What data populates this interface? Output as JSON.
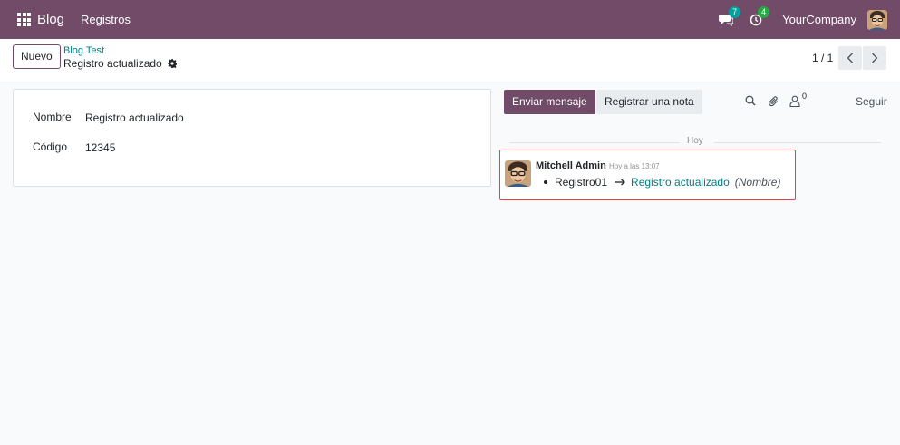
{
  "app": {
    "brand": "Blog",
    "menu_item": "Registros"
  },
  "systray": {
    "messages_count": "7",
    "activities_count": "4",
    "company": "YourCompany",
    "colors": {
      "navbar": "#714b67",
      "messages_badge": "#00a09d",
      "activities_badge": "#28a745"
    }
  },
  "control_panel": {
    "new_button": "Nuevo",
    "breadcrumb_parent": "Blog Test",
    "breadcrumb_current": "Registro actualizado",
    "pager_value": "1 / 1"
  },
  "form": {
    "fields": [
      {
        "label": "Nombre",
        "value": "Registro actualizado"
      },
      {
        "label": "Código",
        "value": "12345"
      }
    ]
  },
  "chatter": {
    "send_message": "Enviar mensaje",
    "log_note": "Registrar una nota",
    "followers_count": "0",
    "follow": "Seguir",
    "date_separator": "Hoy",
    "message": {
      "author": "Mitchell Admin",
      "date": "Hoy a las 13:07",
      "old_value": "Registro01",
      "new_value": "Registro actualizado",
      "field_name": "(Nombre)",
      "highlight_color": "#e0414b"
    }
  }
}
